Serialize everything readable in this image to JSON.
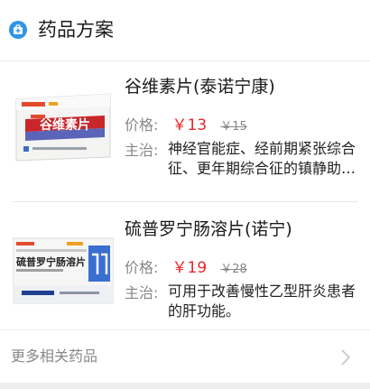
{
  "header": {
    "title": "药品方案",
    "icon": "medicine-kit-icon"
  },
  "price_label": "价格:",
  "treat_label": "主治:",
  "drugs": [
    {
      "name": "谷维素片(泰诺宁康)",
      "price": "￥13",
      "original_price": "￥15",
      "indication": "神经官能症、经前期紧张综合征、更年期综合征的镇静助眠。",
      "box_title": "谷维素片"
    },
    {
      "name": "硫普罗宁肠溶片(诺宁)",
      "price": "￥19",
      "original_price": "￥28",
      "indication": "可用于改善慢性乙型肝炎患者的肝功能。",
      "box_title": "硫普罗宁肠溶片"
    }
  ],
  "more": {
    "label": "更多相关药品",
    "icon": "chevron-right-icon"
  },
  "colors": {
    "accent": "#2f94e6",
    "price": "#e8262b"
  }
}
